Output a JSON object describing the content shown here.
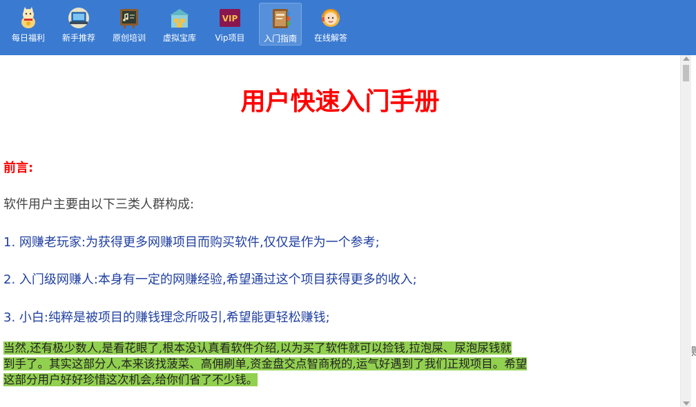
{
  "toolbar": {
    "items": [
      {
        "label": "每日福利",
        "icon": "lucky-cat-icon"
      },
      {
        "label": "新手推荐",
        "icon": "laptop-icon"
      },
      {
        "label": "原创培训",
        "icon": "chalkboard-icon"
      },
      {
        "label": "虚拟宝库",
        "icon": "warehouse-icon"
      },
      {
        "label": "Vip项目",
        "icon": "vip-icon"
      },
      {
        "label": "入门指南",
        "icon": "guide-book-icon"
      },
      {
        "label": "在线解答",
        "icon": "support-agent-icon"
      }
    ],
    "active_item": "入门指南",
    "background": "#3a7bd1"
  },
  "content": {
    "title": "用户快速入门手册",
    "preface_label": "前言:",
    "intro": "软件用户主要由以下三类人群构成:",
    "points": [
      "1. 网赚老玩家:为获得更多网赚项目而购买软件,仅仅是作为一个参考;",
      "2. 入门级网赚人:本身有一定的网赚经验,希望通过这个项目获得更多的收入;",
      "3. 小白:纯粹是被项目的赚钱理念所吸引,希望能更轻松赚钱;"
    ],
    "highlight_lines": [
      "当然,还有极少数人,是看花眼了,根本没认真看软件介绍,以为买了软件就可以捡钱,拉泡屎、尿泡尿钱就",
      "到手了。其实这部分人,本来该找菠菜、高佣刷单,资金盘交点智商税的,运气好遇到了我们正规项目。希望",
      "这部分用户好好珍惜这次机会,给你们省了不少钱。"
    ],
    "edge_glyph": "赊"
  },
  "colors": {
    "title": "#ff0000",
    "point_text": "#1f3fa0",
    "highlight": "#92d050"
  }
}
